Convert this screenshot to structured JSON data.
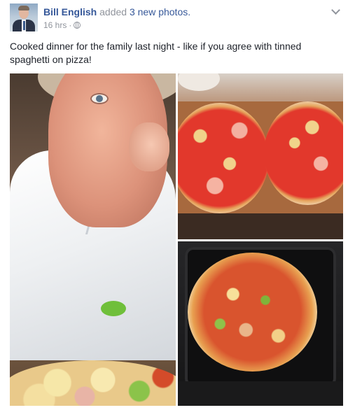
{
  "post": {
    "author": "Bill English",
    "action": "added",
    "photos_link": "3 new photos.",
    "time": "16 hrs",
    "dot": "·",
    "text": "Cooked dinner for the family last night - like if you agree with tinned spaghetti on pizza!"
  },
  "icons": {
    "audience": "globe-icon",
    "menu": "chevron-down-icon"
  },
  "colors": {
    "link": "#365899",
    "meta": "#90949c",
    "text": "#1d2129"
  }
}
